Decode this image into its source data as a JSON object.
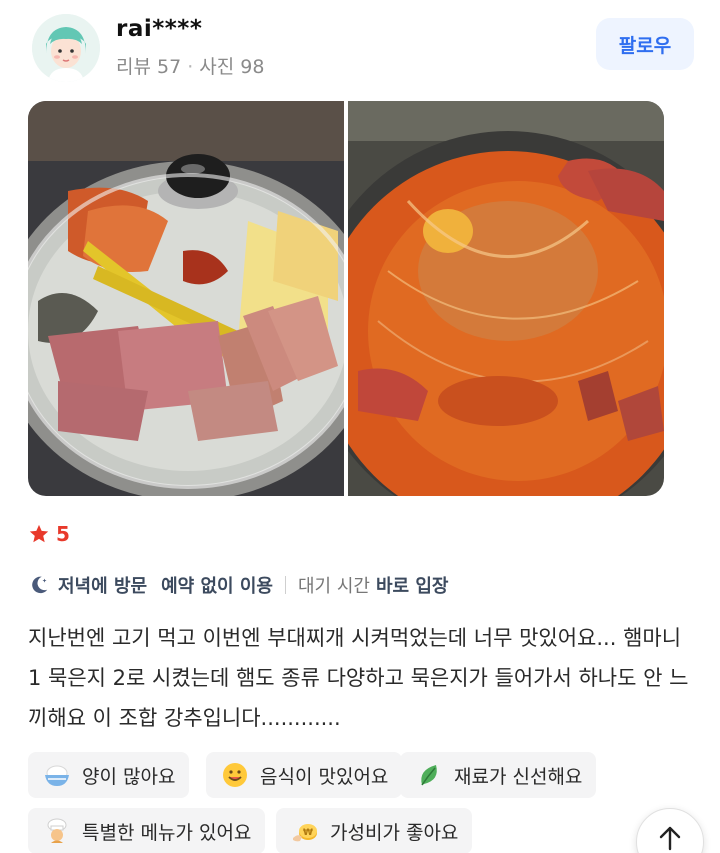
{
  "user": {
    "name": "rai****",
    "reviews_label": "리뷰 57",
    "photos_label": "사진 98",
    "follow_label": "팔로우"
  },
  "photos": [
    {
      "icon": "budae-jjigae-raw-photo"
    },
    {
      "icon": "budae-jjigae-boiled-photo"
    }
  ],
  "rating": {
    "value": "5",
    "color": "#e8392b"
  },
  "visit": {
    "time": "저녁에 방문",
    "reservation": "예약 없이 이용",
    "wait_label": "대기 시간",
    "wait_value": "바로 입장"
  },
  "review": {
    "text": "지난번엔 고기 먹고 이번엔 부대찌개 시켜먹었는데 너무 맛있어요... 햄마니 1 묵은지 2로 시켰는데 햄도 종류 다양하고 묵은지가 들어가서 하나도 안 느끼해요 이 조합 강추입니다............"
  },
  "tags": [
    {
      "label": "양이 많아요",
      "icon": "rice-bowl-icon"
    },
    {
      "label": "음식이 맛있어요",
      "icon": "smile-icon"
    },
    {
      "label": "재료가 신선해요",
      "icon": "leaf-icon"
    },
    {
      "label": "특별한 메뉴가 있어요",
      "icon": "chef-icon"
    },
    {
      "label": "가성비가 좋아요",
      "icon": "coin-icon"
    }
  ],
  "colors": {
    "accent": "#2f6ef0",
    "star": "#e8392b",
    "tag_bg": "#f4f4f5"
  }
}
